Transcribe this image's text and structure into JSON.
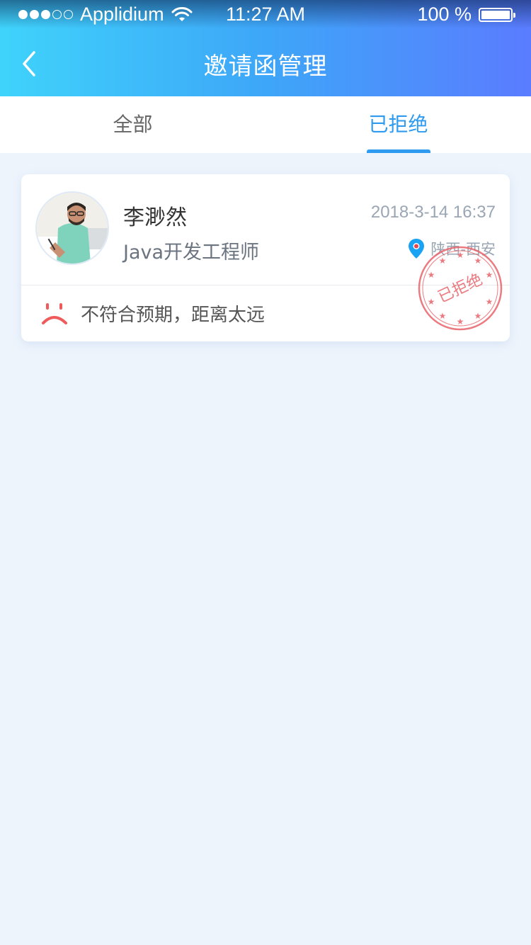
{
  "status_bar": {
    "carrier": "Applidium",
    "time": "11:27 AM",
    "battery": "100 %",
    "signal_icon": "signal-dots-icon",
    "wifi_icon": "wifi-icon",
    "battery_icon": "battery-icon"
  },
  "nav": {
    "title": "邀请函管理",
    "back_icon": "chevron-left-icon"
  },
  "tabs": [
    {
      "label": "全部",
      "active": false
    },
    {
      "label": "已拒绝",
      "active": true
    }
  ],
  "card": {
    "name": "李渺然",
    "datetime": "2018-3-14  16:37",
    "job_title": "Java开发工程师",
    "location": "陕西-西安",
    "reason": "不符合预期，距离太远",
    "stamp_text": "已拒绝"
  },
  "colors": {
    "accent": "#2e9bf0",
    "stamp": "#e8646b",
    "background": "#eef4fc"
  }
}
